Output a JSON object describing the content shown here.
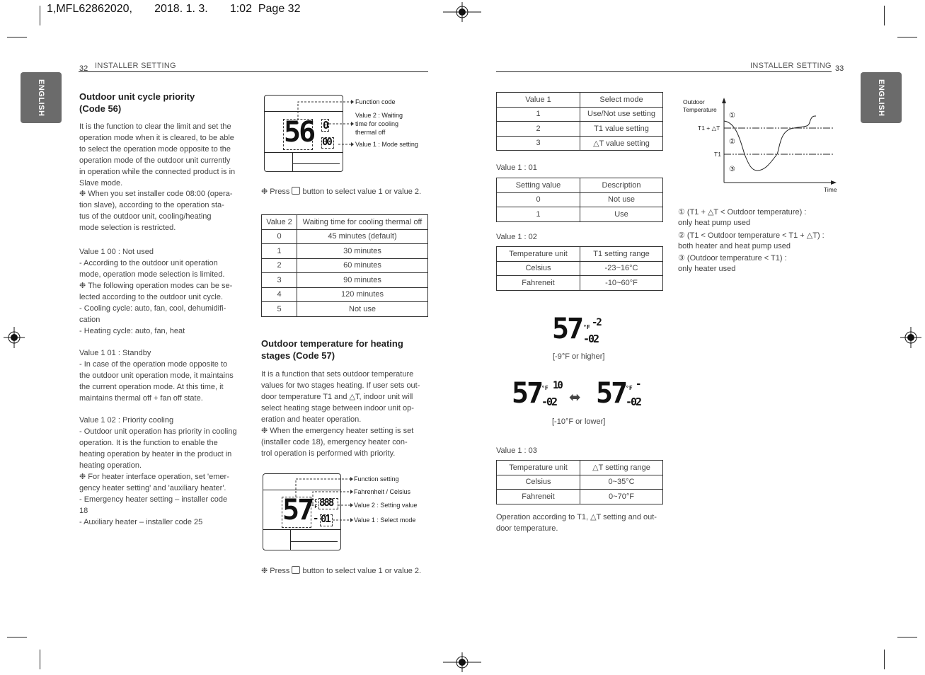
{
  "print_header": "1,MFL62862020,       2018. 1. 3.       1:02  Page 32",
  "left_page": {
    "number": "32",
    "running_title": "INSTALLER SETTING",
    "side_tab": "ENGLISH",
    "sec56_title": "Outdoor unit cycle priority\n(Code 56)",
    "p1": "It is the function to clear the limit and set the\noperation mode when it is cleared, to be able\nto select the operation mode opposite to the\noperation mode of the outdoor unit currently\nin operation while the connected product is in\nSlave mode.",
    "p2": "❉ When you set installer code 08:00 (opera-\n    tion slave), according to the operation sta-\n    tus of the outdoor unit, cooling/heating\n    mode selection is restricted.",
    "p3": "Value 1 00 : Not used\n- According to the outdoor unit operation\n  mode, operation mode selection is limited.\n❉ The following operation modes can be se-\n    lected according to the outdoor unit cycle.\n    - Cooling cycle: auto, fan, cool, dehumidifi-\n      cation\n    - Heating cycle: auto, fan, heat",
    "p4": "Value 1 01 : Standby\n- In case of the operation mode opposite to\n  the outdoor unit operation mode, it maintains\n  the current operation mode. At this time, it\n  maintains thermal off + fan off state.",
    "p5": "Value 1 02 : Priority cooling\n- Outdoor unit operation has priority in cooling\n  operation. It is the function to enable the\n  heating operation by heater in the product in\n  heating operation.\n❉ For heater interface operation, set 'emer-\n    gency heater setting' and 'auxiliary heater'.\n    - Emergency heater setting – installer code\n      18\n    - Auxiliary heater – installer code 25",
    "lcd56": {
      "code": "56",
      "v2": "0",
      "v1": "00",
      "labels": [
        "Function code",
        "Value 2 : Waiting\ntime for cooling\nthermal off",
        "Value 1 : Mode setting"
      ]
    },
    "press_note": "❉ Press",
    "press_note2": "button to select value 1 or value 2.",
    "table56": {
      "headers": [
        "Value 2",
        "Waiting time for cooling thermal off"
      ],
      "rows": [
        [
          "0",
          "45 minutes (default)"
        ],
        [
          "1",
          "30 minutes"
        ],
        [
          "2",
          "60 minutes"
        ],
        [
          "3",
          "90 minutes"
        ],
        [
          "4",
          "120 minutes"
        ],
        [
          "5",
          "Not use"
        ]
      ]
    },
    "sec57_title": "Outdoor temperature for heating\nstages (Code 57)",
    "p57": "It is a function that sets outdoor temperature\nvalues for two stages heating. If user sets out-\ndoor temperature T1 and △T, indoor unit will\nselect heating stage between indoor unit op-\neration and heater operation.\n❉ When the emergency heater setting is set\n    (installer code 18), emergency heater con-\n    trol operation is performed with priority.",
    "lcd57": {
      "code": "57",
      "unit": "°C\n°F",
      "v2": "888",
      "v1": "01",
      "labels": [
        "Function setting",
        "Fahrenheit / Celsius",
        "Value 2 : Setting value",
        "Value 1 : Select mode"
      ]
    }
  },
  "right_page": {
    "number": "33",
    "running_title": "INSTALLER SETTING",
    "side_tab": "ENGLISH",
    "table_mode": {
      "headers": [
        "Value 1",
        "Select mode"
      ],
      "rows": [
        [
          "1",
          "Use/Not use setting"
        ],
        [
          "2",
          "T1 value setting"
        ],
        [
          "3",
          "△T value setting"
        ]
      ]
    },
    "v101_label": "Value 1 : 01",
    "table_v101": {
      "headers": [
        "Setting value",
        "Description"
      ],
      "rows": [
        [
          "0",
          "Not use"
        ],
        [
          "1",
          "Use"
        ]
      ]
    },
    "v102_label": "Value 1 : 02",
    "table_v102": {
      "headers": [
        "Temperature unit",
        "T1 setting range"
      ],
      "rows": [
        [
          "Celsius",
          "-23~16°C"
        ],
        [
          "Fahreneit",
          "-10~60°F"
        ]
      ]
    },
    "disp1": {
      "code": "57",
      "unit": "°F",
      "v2": "-2",
      "v1": "-02",
      "caption": "[-9°F or higher]"
    },
    "disp2": {
      "code": "57",
      "unit": "°F",
      "v2a": "10",
      "v2b": "-",
      "v1": "-02",
      "caption": "[-10°F or lower]"
    },
    "v103_label": "Value 1 : 03",
    "table_v103": {
      "headers": [
        "Temperature unit",
        "△T setting range"
      ],
      "rows": [
        [
          "Celsius",
          "0~35°C"
        ],
        [
          "Fahreneit",
          "0~70°F"
        ]
      ]
    },
    "op_note": "Operation according to T1, △T setting and out-\ndoor temperature.",
    "graph": {
      "ylabel": "Outdoor\nTemperature",
      "xlabel": "Time",
      "level_hi": "T1 + △T",
      "level_lo": "T1",
      "zones": [
        "①",
        "②",
        "③"
      ]
    },
    "legend": [
      "① (T1 + △T < Outdoor temperature) :\n    only heat pump used",
      "② (T1 < Outdoor temperature < T1 + △T) :\n    both heater and heat pump used",
      "③ (Outdoor temperature < T1) :\n    only heater used"
    ]
  }
}
